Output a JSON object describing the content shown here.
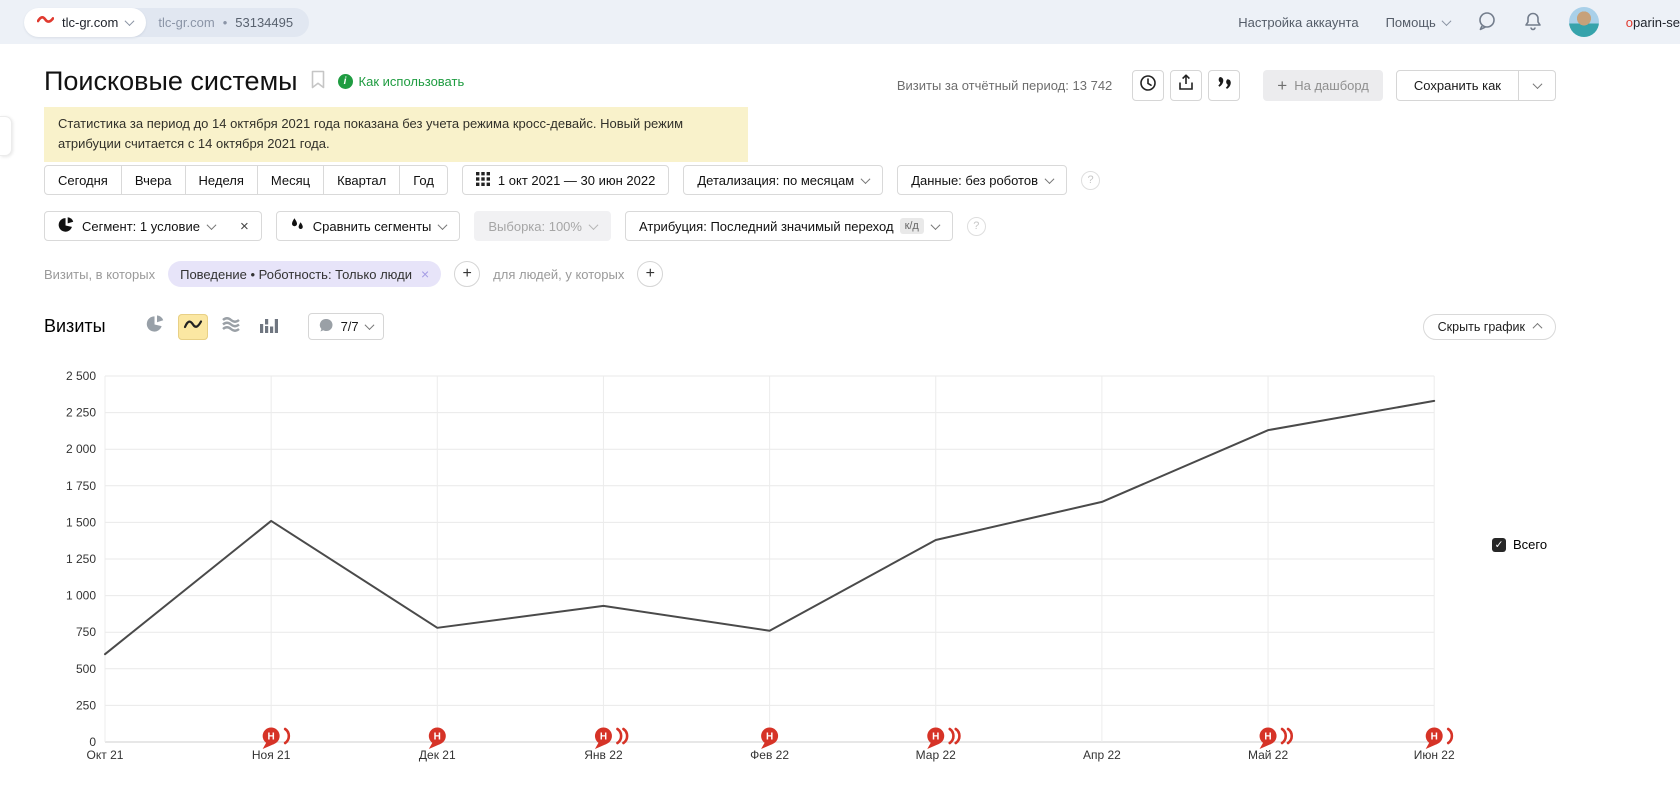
{
  "topbar": {
    "counter_selector": {
      "name": "tlc-gr.com"
    },
    "counter_info": {
      "name": "tlc-gr.com",
      "separator": "•",
      "id": "53134495"
    },
    "account_settings": "Настройка аккаунта",
    "help": "Помощь",
    "username": "oparin-se"
  },
  "header": {
    "title": "Поисковые системы",
    "how_to_use_link": "Как использовать",
    "visits_period": {
      "label": "Визиты за отчётный период:",
      "value": "13 742"
    },
    "add_to_dashboard": "На дашборд",
    "save_as": "Сохранить как"
  },
  "notice": {
    "text": "Статистика за период до 14 октября 2021 года показана без учета режима кросс-девайс. Новый режим атрибуции считается с 14 октября 2021 года."
  },
  "filters": {
    "period_tabs": [
      "Сегодня",
      "Вчера",
      "Неделя",
      "Месяц",
      "Квартал",
      "Год"
    ],
    "date_range": "1 окт 2021 — 30 июн 2022",
    "detalization": "Детализация: по месяцам",
    "data_mode": "Данные: без роботов",
    "segment": "Сегмент: 1 условие",
    "compare_segments": "Сравнить сегменты",
    "sampling": "Выборка: 100%",
    "attribution": "Атрибуция: Последний значимый переход",
    "attribution_badge": "к/д"
  },
  "segment_row": {
    "visits_label": "Визиты, в которых",
    "chip": "Поведение • Роботность: Только люди",
    "people_label": "для людей, у которых"
  },
  "chart_header": {
    "metric": "Визиты",
    "annotations_selector": "7/7",
    "hide_chart": "Скрыть график"
  },
  "legend": {
    "total": "Всего"
  },
  "icons": {
    "plus": "+",
    "close": "×",
    "question": "?",
    "info": "i",
    "check": "✓",
    "dot": "•",
    "names": [
      "metrica-logo-icon",
      "chevron-down-icon",
      "chat-bubble-icon",
      "bell-icon",
      "avatar",
      "bookmark-icon",
      "info-icon",
      "clock-icon",
      "export-icon",
      "quotes-icon",
      "calendar-grid-icon",
      "segment-pie-icon",
      "compare-drops-icon",
      "pie-chart-icon",
      "line-chart-icon",
      "area-chart-icon",
      "column-chart-icon",
      "note-bubble-icon",
      "checkbox-icon"
    ]
  },
  "colors": {
    "topbar_bg": "#edf1f7",
    "notice_bg": "#f9f2cb",
    "selected_yellow": "#fbe7a2",
    "chip_bg": "#e7e4f9",
    "link_green": "#1f9c41",
    "marker_red": "#d63327",
    "line": "#4a4a4a"
  },
  "chart_data": {
    "type": "line",
    "title": "Визиты",
    "x": [
      "Окт 21",
      "Ноя 21",
      "Дек 21",
      "Янв 22",
      "Фев 22",
      "Мар 22",
      "Апр 22",
      "Май 22",
      "Июн 22"
    ],
    "series": [
      {
        "name": "Всего",
        "values": [
          600,
          1510,
          780,
          930,
          760,
          1380,
          1640,
          2130,
          2330
        ]
      }
    ],
    "ylim": [
      0,
      2500
    ],
    "ytick_step": 250,
    "yticks": [
      "0",
      "250",
      "500",
      "750",
      "1 000",
      "1 250",
      "1 500",
      "1 750",
      "2 000",
      "2 250",
      "2 500"
    ],
    "grid": true,
    "legend_position": "right",
    "line_color": "#4a4a4a",
    "note_marker_label": "Н",
    "note_markers": [
      {
        "month_index": 1,
        "extra_arcs": 1
      },
      {
        "month_index": 2,
        "extra_arcs": 0
      },
      {
        "month_index": 3,
        "extra_arcs": 2
      },
      {
        "month_index": 4,
        "extra_arcs": 0
      },
      {
        "month_index": 5,
        "extra_arcs": 2
      },
      {
        "month_index": 7,
        "extra_arcs": 2
      },
      {
        "month_index": 8,
        "extra_arcs": 1
      }
    ]
  }
}
